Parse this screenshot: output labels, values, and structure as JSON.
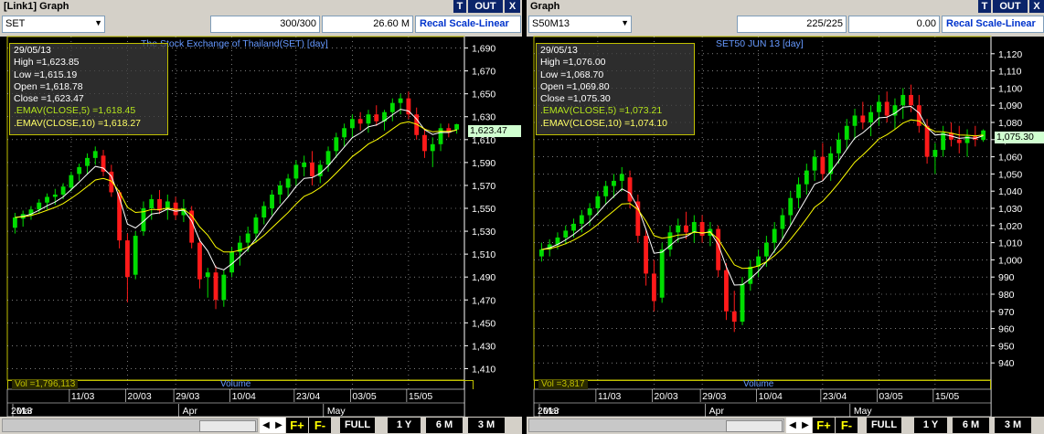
{
  "panels": [
    {
      "title": "[Link1] Graph",
      "buttons": {
        "t": "T",
        "out": "OUT",
        "x": "X"
      },
      "symbol": "SET",
      "count": "300/300",
      "value": "26.60 M",
      "recal": "Recal Scale-Linear",
      "chart_title": "The Stock Exchange of Thailand(SET) [day]",
      "info": {
        "date": "29/05/13",
        "high": "High  =1,623.85",
        "low": "Low  =1,615.19",
        "open": "Open  =1,618.78",
        "close": "Close  =1,623.47",
        "ema5": ".EMAV(CLOSE,5)   =1,618.45",
        "ema10": ".EMAV(CLOSE,10)  =1,618.27"
      },
      "last_price": "1,623.47",
      "vol_label": "Vol  =1,796,113",
      "volume_label": "Volume",
      "nav": {
        "fplus": "F+",
        "fminus": "F-",
        "full": "FULL",
        "y1": "1 Y",
        "m6": "6 M",
        "m3": "3 M"
      }
    },
    {
      "title": "Graph",
      "buttons": {
        "t": "T",
        "out": "OUT",
        "x": "X"
      },
      "symbol": "S50M13",
      "count": "225/225",
      "value": "0.00",
      "recal": "Recal Scale-Linear",
      "chart_title": "SET50 JUN 13  [day]",
      "info": {
        "date": "29/05/13",
        "high": "High  =1,076.00",
        "low": "Low  =1,068.70",
        "open": "Open  =1,069.80",
        "close": "Close  =1,075.30",
        "ema5": ".EMAV(CLOSE,5)   =1,073.21",
        "ema10": ".EMAV(CLOSE,10)  =1,074.10"
      },
      "last_price": "1,075.30",
      "vol_label": "Vol  =3,817",
      "volume_label": "Volume",
      "nav": {
        "fplus": "F+",
        "fminus": "F-",
        "full": "FULL",
        "y1": "1 Y",
        "m6": "6 M",
        "m3": "3 M"
      }
    }
  ],
  "colors": {
    "up": "#00dd00",
    "down": "#ff1a1a",
    "ema5": "#ffffff",
    "ema10": "#ffff00",
    "grid": "#c8c8c8",
    "axis": "#ffffff",
    "title": "#6699ff",
    "frame": "#c0c000"
  },
  "chart_data": [
    {
      "type": "candlestick",
      "title": "The Stock Exchange of Thailand(SET) [day]",
      "ylim": [
        1400,
        1700
      ],
      "yticks": [
        "1,690",
        "1,670",
        "1,650",
        "1,630",
        "1,610",
        "1,590",
        "1,570",
        "1,550",
        "1,530",
        "1,510",
        "1,490",
        "1,470",
        "1,450",
        "1,430",
        "1,410"
      ],
      "ytick_values": [
        1690,
        1670,
        1650,
        1630,
        1610,
        1590,
        1570,
        1550,
        1530,
        1510,
        1490,
        1470,
        1450,
        1430,
        1410
      ],
      "xticks": [
        {
          "label": "11/03",
          "index": 7
        },
        {
          "label": "20/03",
          "index": 14
        },
        {
          "label": "29/03",
          "index": 20
        },
        {
          "label": "10/04",
          "index": 27
        },
        {
          "label": "23/04",
          "index": 35
        },
        {
          "label": "03/05",
          "index": 42
        },
        {
          "label": "15/05",
          "index": 49
        }
      ],
      "month_labels": [
        {
          "label": "Mar",
          "index": 0
        },
        {
          "label": "Apr",
          "index": 22
        },
        {
          "label": "May",
          "index": 40
        }
      ],
      "year_label": "2013",
      "n": 56,
      "candles": [
        [
          1533,
          1546,
          1528,
          1542
        ],
        [
          1541,
          1548,
          1534,
          1545
        ],
        [
          1544,
          1552,
          1540,
          1549
        ],
        [
          1549,
          1558,
          1546,
          1555
        ],
        [
          1555,
          1563,
          1549,
          1560
        ],
        [
          1560,
          1567,
          1553,
          1562
        ],
        [
          1562,
          1572,
          1558,
          1569
        ],
        [
          1568,
          1582,
          1565,
          1579
        ],
        [
          1580,
          1589,
          1574,
          1586
        ],
        [
          1587,
          1598,
          1580,
          1594
        ],
        [
          1594,
          1604,
          1588,
          1600
        ],
        [
          1596,
          1601,
          1578,
          1582
        ],
        [
          1582,
          1588,
          1560,
          1564
        ],
        [
          1564,
          1566,
          1515,
          1522
        ],
        [
          1522,
          1528,
          1468,
          1490
        ],
        [
          1492,
          1530,
          1488,
          1526
        ],
        [
          1530,
          1556,
          1526,
          1550
        ],
        [
          1550,
          1562,
          1540,
          1558
        ],
        [
          1558,
          1566,
          1545,
          1548
        ],
        [
          1549,
          1562,
          1540,
          1556
        ],
        [
          1555,
          1560,
          1540,
          1544
        ],
        [
          1544,
          1558,
          1538,
          1550
        ],
        [
          1548,
          1552,
          1515,
          1520
        ],
        [
          1520,
          1524,
          1480,
          1488
        ],
        [
          1490,
          1498,
          1472,
          1494
        ],
        [
          1494,
          1500,
          1462,
          1470
        ],
        [
          1470,
          1496,
          1464,
          1492
        ],
        [
          1494,
          1516,
          1490,
          1512
        ],
        [
          1512,
          1526,
          1500,
          1520
        ],
        [
          1520,
          1534,
          1512,
          1528
        ],
        [
          1528,
          1545,
          1520,
          1542
        ],
        [
          1542,
          1556,
          1536,
          1552
        ],
        [
          1550,
          1566,
          1544,
          1562
        ],
        [
          1562,
          1574,
          1554,
          1570
        ],
        [
          1568,
          1580,
          1560,
          1576
        ],
        [
          1576,
          1592,
          1570,
          1588
        ],
        [
          1586,
          1596,
          1578,
          1590
        ],
        [
          1590,
          1600,
          1570,
          1578
        ],
        [
          1578,
          1592,
          1572,
          1588
        ],
        [
          1588,
          1604,
          1582,
          1600
        ],
        [
          1600,
          1616,
          1594,
          1612
        ],
        [
          1612,
          1624,
          1604,
          1620
        ],
        [
          1620,
          1632,
          1612,
          1628
        ],
        [
          1628,
          1634,
          1618,
          1624
        ],
        [
          1624,
          1636,
          1616,
          1632
        ],
        [
          1632,
          1640,
          1622,
          1626
        ],
        [
          1626,
          1636,
          1618,
          1634
        ],
        [
          1634,
          1646,
          1626,
          1642
        ],
        [
          1642,
          1650,
          1632,
          1646
        ],
        [
          1646,
          1652,
          1628,
          1632
        ],
        [
          1632,
          1638,
          1610,
          1614
        ],
        [
          1614,
          1620,
          1594,
          1600
        ],
        [
          1600,
          1612,
          1586,
          1606
        ],
        [
          1606,
          1624,
          1600,
          1620
        ],
        [
          1620,
          1624,
          1612,
          1616
        ],
        [
          1618.78,
          1623.85,
          1615.19,
          1623.47
        ]
      ]
    },
    {
      "type": "candlestick",
      "title": "SET50 JUN 13  [day]",
      "ylim": [
        930,
        1130
      ],
      "yticks": [
        "1,120",
        "1,110",
        "1,100",
        "1,090",
        "1,080",
        "1,070",
        "1,060",
        "1,050",
        "1,040",
        "1,030",
        "1,020",
        "1,010",
        "1,000",
        "990",
        "980",
        "970",
        "960",
        "950",
        "940"
      ],
      "ytick_values": [
        1120,
        1110,
        1100,
        1090,
        1080,
        1070,
        1060,
        1050,
        1040,
        1030,
        1020,
        1010,
        1000,
        990,
        980,
        970,
        960,
        950,
        940
      ],
      "xticks": [
        {
          "label": "11/03",
          "index": 7
        },
        {
          "label": "20/03",
          "index": 14
        },
        {
          "label": "29/03",
          "index": 20
        },
        {
          "label": "10/04",
          "index": 27
        },
        {
          "label": "23/04",
          "index": 35
        },
        {
          "label": "03/05",
          "index": 42
        },
        {
          "label": "15/05",
          "index": 49
        }
      ],
      "month_labels": [
        {
          "label": "Mar",
          "index": 0
        },
        {
          "label": "Apr",
          "index": 22
        },
        {
          "label": "May",
          "index": 40
        }
      ],
      "year_label": "2013",
      "n": 56,
      "candles": [
        [
          1002,
          1010,
          999,
          1006
        ],
        [
          1006,
          1012,
          1002,
          1009
        ],
        [
          1009,
          1016,
          1006,
          1013
        ],
        [
          1013,
          1020,
          1009,
          1017
        ],
        [
          1017,
          1024,
          1013,
          1021
        ],
        [
          1021,
          1029,
          1016,
          1026
        ],
        [
          1026,
          1033,
          1020,
          1030
        ],
        [
          1030,
          1040,
          1026,
          1037
        ],
        [
          1037,
          1046,
          1032,
          1043
        ],
        [
          1043,
          1050,
          1036,
          1046
        ],
        [
          1046,
          1054,
          1040,
          1050
        ],
        [
          1048,
          1052,
          1030,
          1034
        ],
        [
          1034,
          1038,
          1010,
          1014
        ],
        [
          1014,
          1018,
          985,
          992
        ],
        [
          992,
          1000,
          970,
          976
        ],
        [
          978,
          1010,
          975,
          1006
        ],
        [
          1006,
          1020,
          1002,
          1016
        ],
        [
          1016,
          1024,
          1010,
          1020
        ],
        [
          1020,
          1028,
          1012,
          1016
        ],
        [
          1016,
          1026,
          1010,
          1022
        ],
        [
          1022,
          1026,
          1010,
          1014
        ],
        [
          1014,
          1022,
          1008,
          1018
        ],
        [
          1018,
          1020,
          990,
          994
        ],
        [
          994,
          998,
          965,
          970
        ],
        [
          970,
          982,
          958,
          964
        ],
        [
          964,
          990,
          962,
          986
        ],
        [
          986,
          1000,
          982,
          996
        ],
        [
          996,
          1006,
          990,
          1002
        ],
        [
          1002,
          1014,
          996,
          1010
        ],
        [
          1010,
          1022,
          1004,
          1018
        ],
        [
          1018,
          1030,
          1012,
          1026
        ],
        [
          1026,
          1040,
          1020,
          1036
        ],
        [
          1036,
          1048,
          1030,
          1044
        ],
        [
          1044,
          1056,
          1038,
          1052
        ],
        [
          1052,
          1064,
          1046,
          1060
        ],
        [
          1060,
          1068,
          1046,
          1050
        ],
        [
          1050,
          1066,
          1046,
          1062
        ],
        [
          1062,
          1074,
          1056,
          1070
        ],
        [
          1070,
          1082,
          1064,
          1078
        ],
        [
          1078,
          1088,
          1070,
          1084
        ],
        [
          1084,
          1092,
          1076,
          1080
        ],
        [
          1080,
          1090,
          1072,
          1086
        ],
        [
          1086,
          1096,
          1078,
          1092
        ],
        [
          1092,
          1098,
          1080,
          1084
        ],
        [
          1084,
          1094,
          1076,
          1090
        ],
        [
          1090,
          1100,
          1082,
          1096
        ],
        [
          1096,
          1102,
          1086,
          1090
        ],
        [
          1090,
          1096,
          1074,
          1078
        ],
        [
          1078,
          1082,
          1056,
          1060
        ],
        [
          1060,
          1068,
          1050,
          1064
        ],
        [
          1064,
          1078,
          1060,
          1074
        ],
        [
          1074,
          1080,
          1066,
          1070
        ],
        [
          1070,
          1078,
          1062,
          1068
        ],
        [
          1068,
          1076,
          1060,
          1072
        ],
        [
          1072,
          1078,
          1066,
          1070
        ],
        [
          1069.8,
          1076,
          1068.7,
          1075.3
        ]
      ]
    }
  ]
}
